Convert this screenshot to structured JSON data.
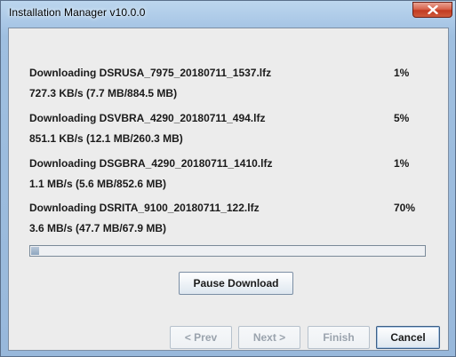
{
  "window": {
    "title": "Installation Manager v10.0.0",
    "close_icon": "close-icon"
  },
  "downloads": [
    {
      "label": "Downloading DSRUSA_7975_20180711_1537.lfz",
      "percent": "1%",
      "speed": "727.3 KB/s (7.7 MB/884.5 MB)"
    },
    {
      "label": "Downloading DSVBRA_4290_20180711_494.lfz",
      "percent": "5%",
      "speed": "851.1 KB/s (12.1 MB/260.3 MB)"
    },
    {
      "label": "Downloading DSGBRA_4290_20180711_1410.lfz",
      "percent": "1%",
      "speed": "1.1 MB/s (5.6 MB/852.6 MB)"
    },
    {
      "label": "Downloading DSRITA_9100_20180711_122.lfz",
      "percent": "70%",
      "speed": "3.6 MB/s (47.7 MB/67.9 MB)"
    }
  ],
  "overall_progress": 0.02,
  "buttons": {
    "pause": "Pause Download",
    "prev": "< Prev",
    "next": "Next >",
    "finish": "Finish",
    "cancel": "Cancel"
  },
  "colors": {
    "close_button": "#c23b22",
    "progress_fill": "#8ea6bf"
  }
}
